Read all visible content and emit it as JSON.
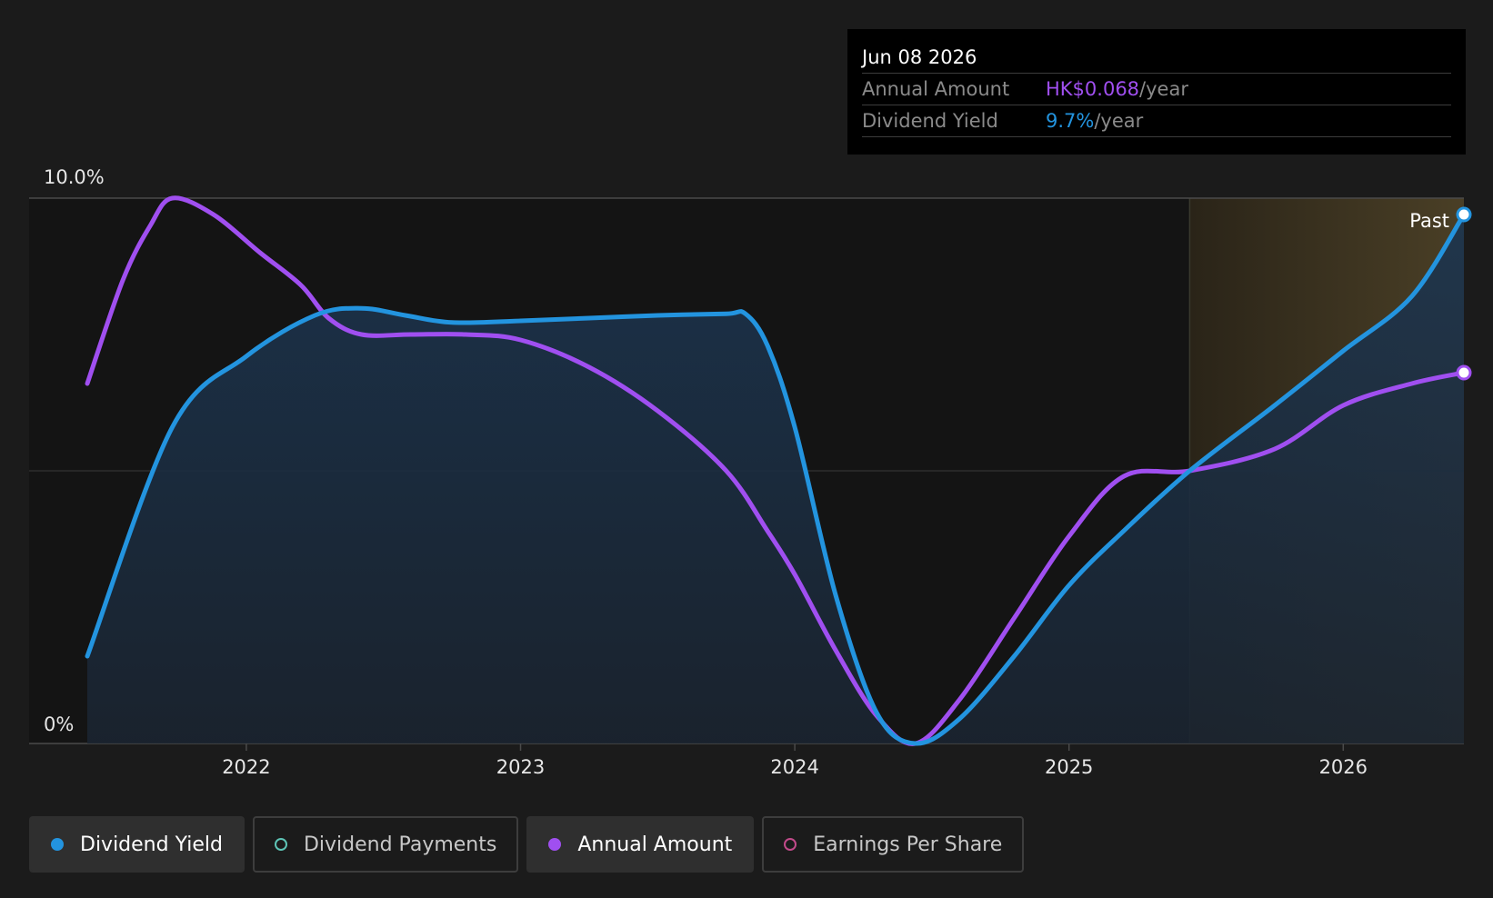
{
  "tooltip": {
    "date": "Jun 08 2026",
    "annual_amount_label": "Annual Amount",
    "annual_amount_value": "HK$0.068",
    "annual_amount_unit": "/year",
    "dividend_yield_label": "Dividend Yield",
    "dividend_yield_value": "9.7%",
    "dividend_yield_unit": "/year"
  },
  "legend": [
    {
      "label": "Dividend Yield",
      "active": true,
      "color": "#2394df",
      "filled": true
    },
    {
      "label": "Dividend Payments",
      "active": false,
      "color": "#5ec4b6",
      "filled": false
    },
    {
      "label": "Annual Amount",
      "active": true,
      "color": "#a04ff0",
      "filled": true
    },
    {
      "label": "Earnings Per Share",
      "active": false,
      "color": "#c24a8a",
      "filled": false
    }
  ],
  "chart_data": {
    "type": "line",
    "x_ticks": [
      "2022",
      "2023",
      "2024",
      "2025",
      "2026"
    ],
    "y_ticks": [
      "0%",
      "10.0%"
    ],
    "xlim": [
      2021.42,
      2026.44
    ],
    "ylim": [
      0,
      10
    ],
    "past_label": "Past",
    "forecast_start": 2025.44,
    "grid": true,
    "colors": {
      "background": "#1b1b1b",
      "yield": "#2394df",
      "amount": "#a04ff0",
      "forecast_shade": "#4a3f26"
    },
    "series": [
      {
        "name": "Dividend Yield",
        "unit": "%",
        "x": [
          2021.42,
          2021.73,
          2022.0,
          2022.25,
          2022.42,
          2022.58,
          2022.75,
          2023.0,
          2023.25,
          2023.5,
          2023.75,
          2023.82,
          2023.9,
          2024.0,
          2024.15,
          2024.3,
          2024.44,
          2024.6,
          2024.8,
          2025.0,
          2025.2,
          2025.44,
          2025.75,
          2026.0,
          2026.25,
          2026.44
        ],
        "y": [
          1.6,
          5.8,
          7.1,
          7.85,
          7.98,
          7.85,
          7.72,
          7.75,
          7.8,
          7.85,
          7.88,
          7.88,
          7.3,
          5.8,
          2.7,
          0.55,
          0.0,
          0.45,
          1.6,
          2.9,
          3.9,
          5.0,
          6.2,
          7.2,
          8.2,
          9.7
        ]
      },
      {
        "name": "Annual Amount",
        "unit": "HK$",
        "x": [
          2021.42,
          2021.55,
          2021.65,
          2021.73,
          2021.88,
          2022.05,
          2022.2,
          2022.3,
          2022.42,
          2022.6,
          2022.8,
          2023.0,
          2023.25,
          2023.5,
          2023.75,
          2023.9,
          2024.0,
          2024.15,
          2024.3,
          2024.44,
          2024.6,
          2024.8,
          2025.0,
          2025.2,
          2025.44,
          2025.75,
          2026.0,
          2026.25,
          2026.44
        ],
        "y": [
          0.066,
          0.085,
          0.095,
          0.1,
          0.097,
          0.09,
          0.084,
          0.078,
          0.075,
          0.075,
          0.075,
          0.074,
          0.069,
          0.061,
          0.05,
          0.039,
          0.031,
          0.017,
          0.005,
          0.0,
          0.008,
          0.023,
          0.038,
          0.049,
          0.05,
          0.054,
          0.062,
          0.066,
          0.068
        ]
      }
    ]
  }
}
